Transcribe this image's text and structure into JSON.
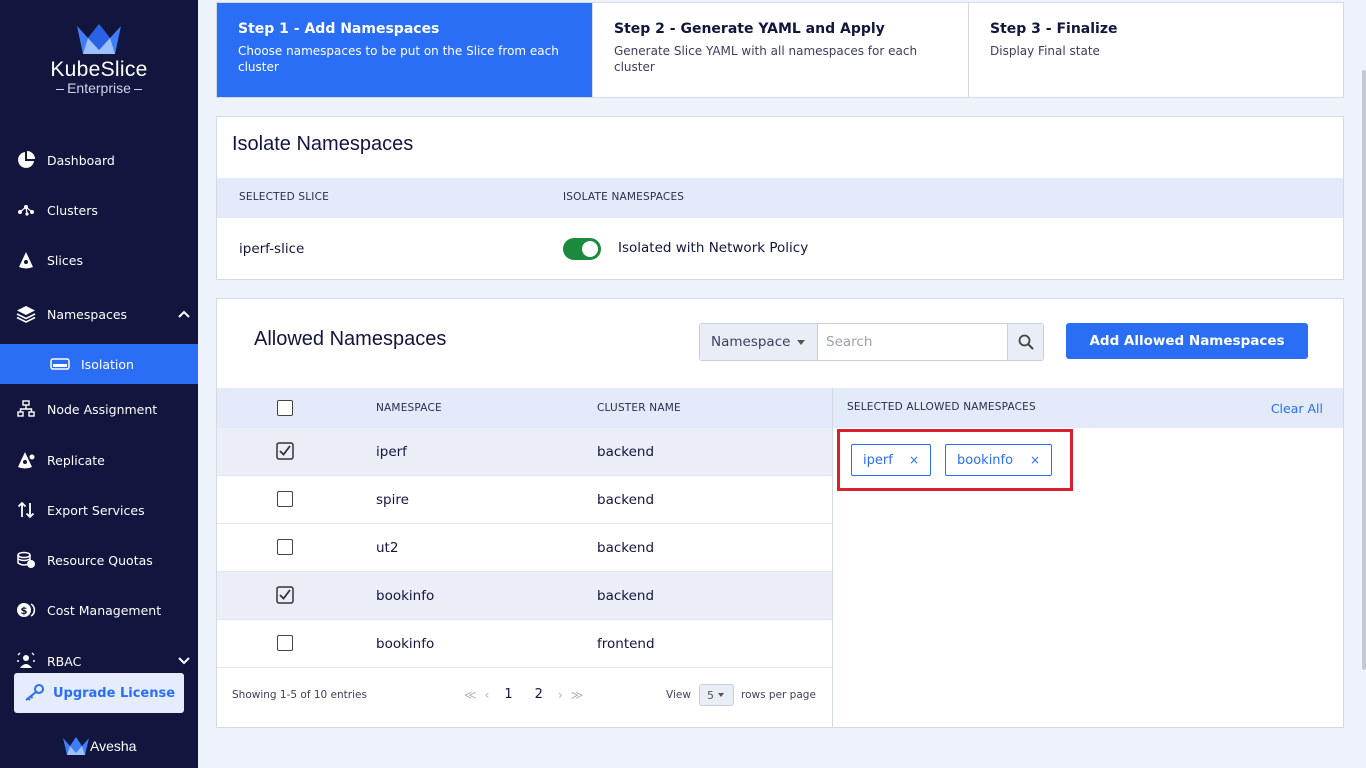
{
  "sidebar": {
    "brand": "KubeSlice",
    "edition": "Enterprise",
    "items": [
      {
        "label": "Dashboard",
        "icon": "pie-chart-icon"
      },
      {
        "label": "Clusters",
        "icon": "cluster-icon"
      },
      {
        "label": "Slices",
        "icon": "slice-icon"
      },
      {
        "label": "Namespaces",
        "icon": "layers-icon"
      },
      {
        "label": "Isolation",
        "icon": "isolation-icon"
      },
      {
        "label": "Node Assignment",
        "icon": "node-tree-icon"
      },
      {
        "label": "Replicate",
        "icon": "replicate-icon"
      },
      {
        "label": "Export Services",
        "icon": "export-arrows-icon"
      },
      {
        "label": "Resource Quotas",
        "icon": "coins-icon"
      },
      {
        "label": "Cost Management",
        "icon": "cost-icon"
      },
      {
        "label": "RBAC",
        "icon": "rbac-icon"
      }
    ],
    "upgrade_label": "Upgrade License",
    "footer_brand": "Avesha"
  },
  "stepper": [
    {
      "title": "Step 1 - Add Namespaces",
      "desc": "Choose namespaces to be put on the Slice from each cluster"
    },
    {
      "title": "Step 2 - Generate YAML and Apply",
      "desc": "Generate Slice YAML with all namespaces for each cluster"
    },
    {
      "title": "Step 3 - Finalize",
      "desc": "Display Final state"
    }
  ],
  "isolate": {
    "title": "Isolate Namespaces",
    "col_slice": "SELECTED SLICE",
    "col_isolate": "ISOLATE NAMESPACES",
    "slice_value": "iperf-slice",
    "toggle_label": "Isolated with Network Policy"
  },
  "allowed": {
    "title": "Allowed Namespaces",
    "filter_label": "Namespace",
    "search_placeholder": "Search",
    "add_button": "Add Allowed Namespaces",
    "col_namespace": "NAMESPACE",
    "col_cluster": "CLUSTER NAME",
    "rows": [
      {
        "namespace": "iperf",
        "cluster": "backend",
        "checked": true
      },
      {
        "namespace": "spire",
        "cluster": "backend",
        "checked": false
      },
      {
        "namespace": "ut2",
        "cluster": "backend",
        "checked": false
      },
      {
        "namespace": "bookinfo",
        "cluster": "backend",
        "checked": true
      },
      {
        "namespace": "bookinfo",
        "cluster": "frontend",
        "checked": false
      }
    ],
    "showing": "Showing 1-5 of 10 entries",
    "pages": [
      "1",
      "2"
    ],
    "view_label": "View",
    "per_page": "5",
    "rows_label": "rows per page",
    "selected_header": "SELECTED ALLOWED NAMESPACES",
    "clear_all": "Clear All",
    "chips": [
      "iperf",
      "bookinfo"
    ],
    "chip_remove": "×"
  },
  "colors": {
    "accent": "#2a6ef6",
    "sidebar_bg": "#12153e",
    "toggle_on": "#1c8a3c",
    "highlight": "#d9202e"
  }
}
